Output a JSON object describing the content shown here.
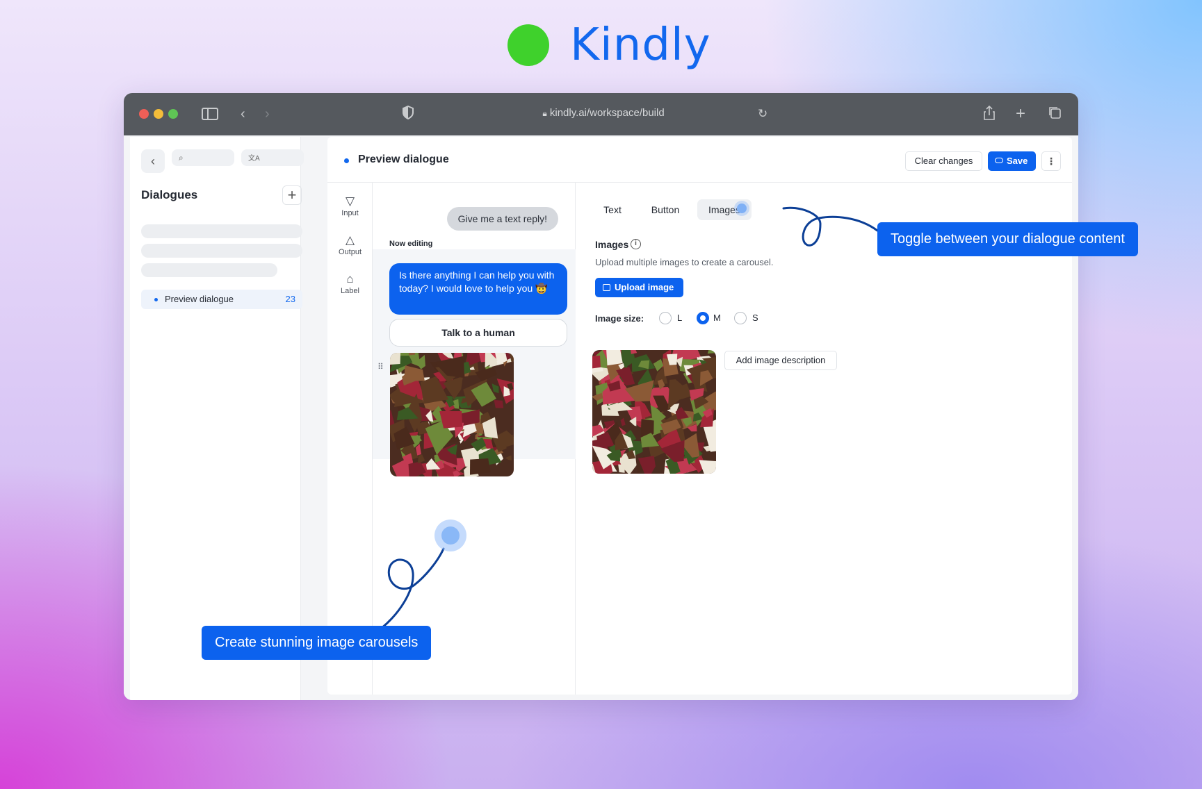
{
  "brand": {
    "name": "Kindly",
    "dot_color": "#3fd12c",
    "text_color": "#1268ee"
  },
  "browser": {
    "url": "kindly.ai/workspace/build"
  },
  "sidebar": {
    "title": "Dialogues",
    "search_icon": "⌕",
    "lang_icon": "文A",
    "active_item": {
      "label": "Preview dialogue",
      "count": "23"
    }
  },
  "header": {
    "title": "Preview dialogue",
    "clear_label": "Clear changes",
    "save_label": "Save",
    "more_label": "⋮"
  },
  "tools": [
    {
      "label": "Input",
      "icon": "▽"
    },
    {
      "label": "Output",
      "icon": "△"
    },
    {
      "label": "Label",
      "icon": "⌂"
    }
  ],
  "preview": {
    "user_message": "Give me a text reply!",
    "now_editing": "Now editing",
    "bot_message": "Is there anything I can help you with today? I would love to help you 🤠",
    "button_label": "Talk to a human"
  },
  "editor": {
    "tabs": [
      "Text",
      "Button",
      "Images"
    ],
    "active_tab": "Images",
    "field_label": "Images",
    "field_help": "Upload multiple images to create a carousel.",
    "upload_label": "Upload image",
    "size_label": "Image size:",
    "sizes": [
      "L",
      "M",
      "S"
    ],
    "selected_size": "M",
    "desc_label": "Add image description"
  },
  "callouts": {
    "toggle": "Toggle between your dialogue content",
    "carousel": "Create stunning image carousels"
  },
  "accent": "#0c62ee"
}
